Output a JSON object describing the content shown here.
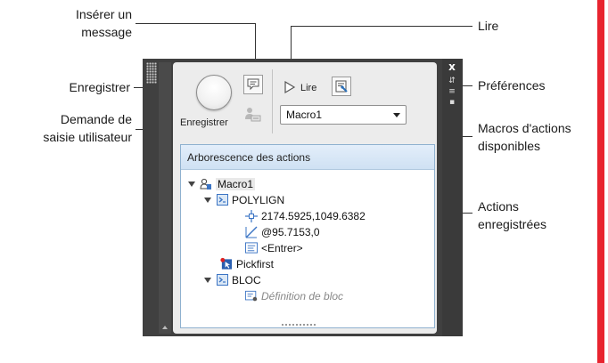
{
  "callouts": {
    "inserer_message_line1": "Insérer un",
    "inserer_message_line2": "message",
    "enregistrer": "Enregistrer",
    "demande_line1": "Demande de",
    "demande_line2": "saisie utilisateur",
    "lire": "Lire",
    "preferences": "Préférences",
    "macros_line1": "Macros d'actions",
    "macros_line2": "disponibles",
    "actions_line1": "Actions",
    "actions_line2": "enregistrées"
  },
  "palette": {
    "close_glyph": "x",
    "record_label": "Enregistrer",
    "play_label": "Lire",
    "macro_selected": "Macro1",
    "tree_header": "Arborescence des actions",
    "tree": {
      "macro": "Macro1",
      "polylign": "POLYLIGN",
      "coord1": "2174.5925,1049.6382",
      "coord2": "@95.7153,0",
      "enter": "<Entrer>",
      "pickfirst": "Pickfirst",
      "bloc": "BLOC",
      "bloc_def": "Définition de bloc"
    }
  },
  "colors": {
    "accent_bar": "#e8242f",
    "panel_dark": "#404040",
    "tree_header": "#d6e6f6"
  }
}
